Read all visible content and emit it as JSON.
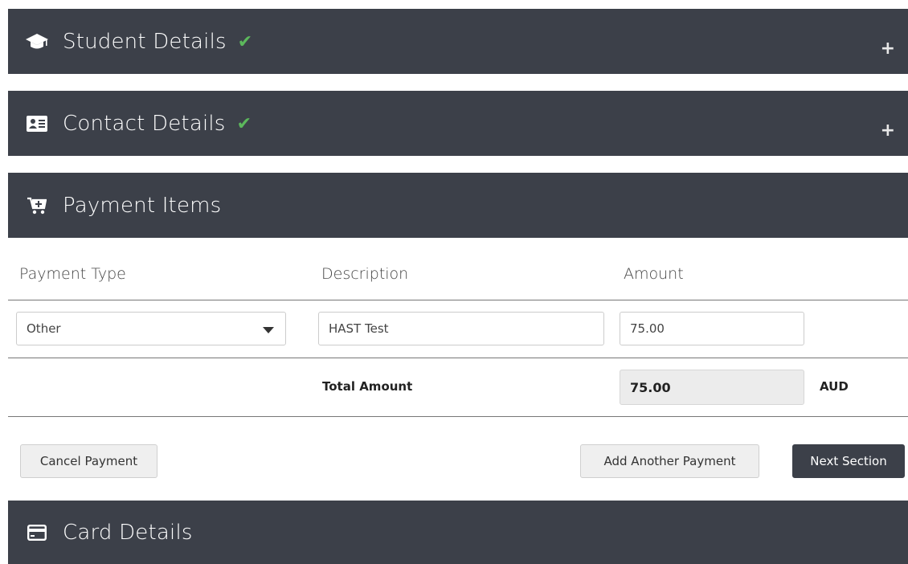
{
  "sections": {
    "student": {
      "title": "Student Details",
      "check": "✔",
      "toggle": "+"
    },
    "contact": {
      "title": "Contact Details",
      "check": "✔",
      "toggle": "+"
    },
    "payment": {
      "title": "Payment Items"
    },
    "card": {
      "title": "Card Details"
    }
  },
  "payment_items": {
    "headers": {
      "type": "Payment Type",
      "description": "Description",
      "amount": "Amount"
    },
    "row": {
      "type": "Other",
      "description": "HAST Test",
      "amount": "75.00"
    },
    "total_label": "Total Amount",
    "total_value": "75.00",
    "currency": "AUD"
  },
  "buttons": {
    "cancel": "Cancel Payment",
    "add": "Add Another Payment",
    "next": "Next Section"
  },
  "colors": {
    "panel": "#3c4049",
    "check": "#5cb85c"
  },
  "icons": [
    "graduation-cap-icon",
    "contact-card-icon",
    "cart-plus-icon",
    "credit-card-icon",
    "plus-icon",
    "check-icon",
    "caret-down-icon"
  ]
}
